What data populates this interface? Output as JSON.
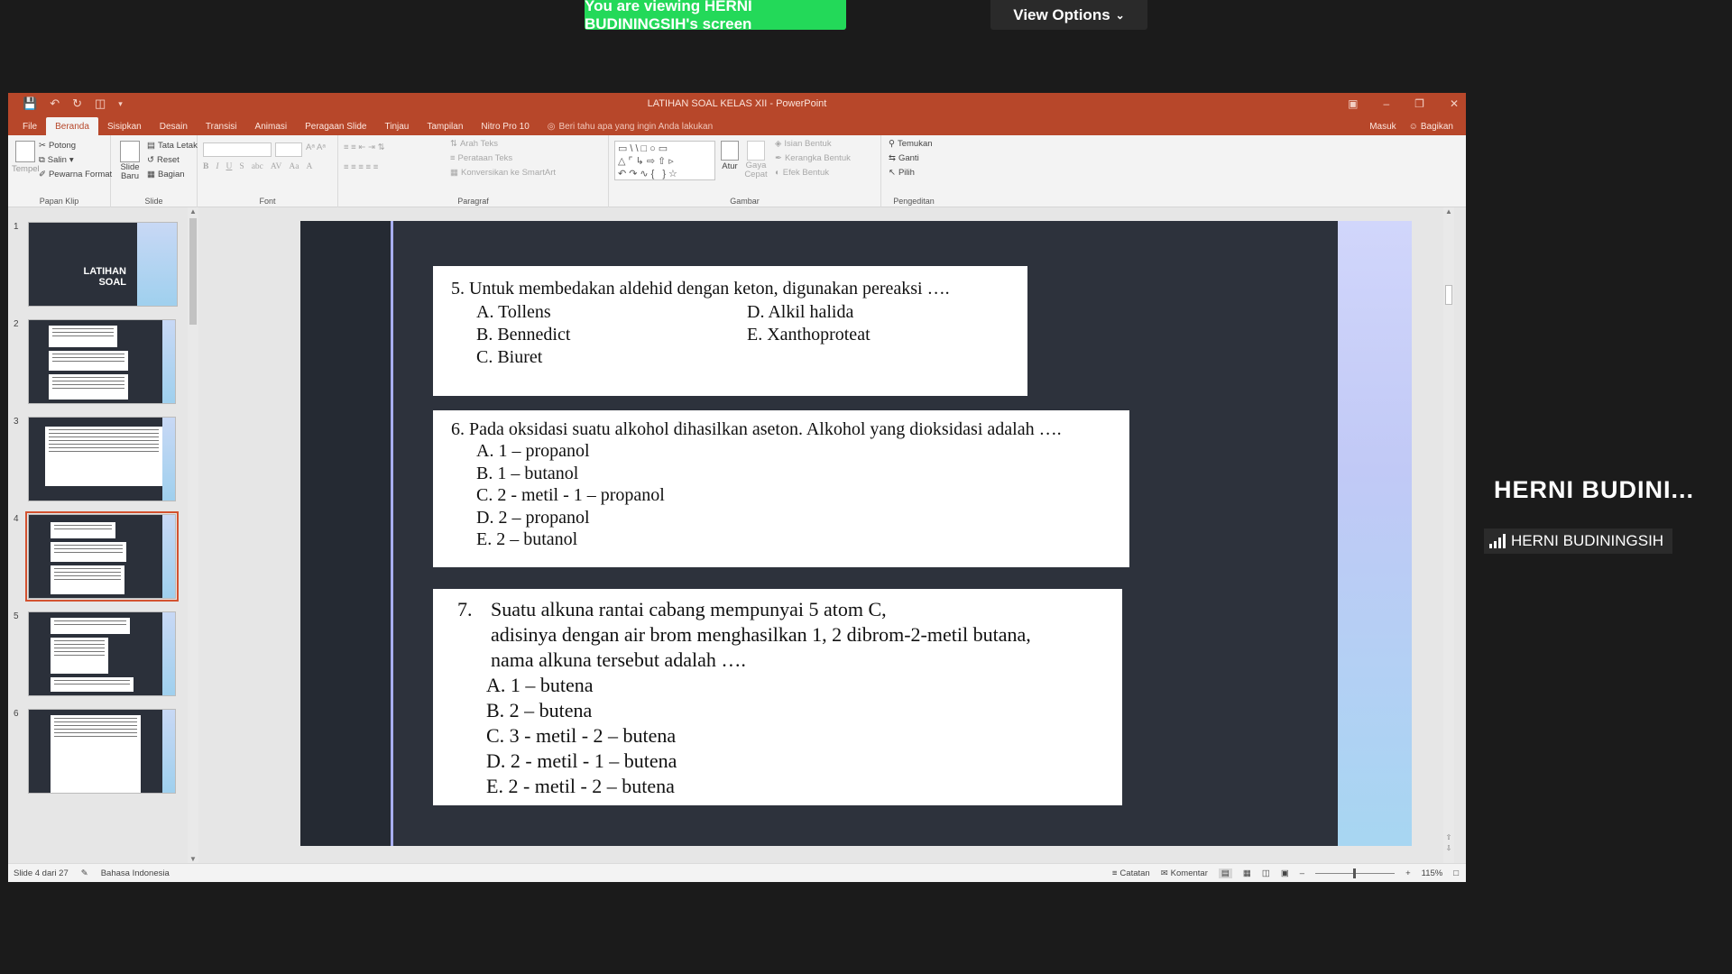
{
  "zoom": {
    "banner": "You are viewing HERNI BUDININGSIH's screen",
    "view_options": "View Options",
    "participant_big": "HERNI  BUDINI...",
    "participant_tag": "HERNI BUDININGSIH"
  },
  "window": {
    "title": "LATIHAN SOAL KELAS XII - PowerPoint"
  },
  "tabs": [
    "File",
    "Beranda",
    "Sisipkan",
    "Desain",
    "Transisi",
    "Animasi",
    "Peragaan Slide",
    "Tinjau",
    "Tampilan",
    "Nitro Pro 10"
  ],
  "active_tab": "Beranda",
  "tell_me": "Beri tahu apa yang ingin Anda lakukan",
  "account": {
    "signin": "Masuk",
    "share": "Bagikan"
  },
  "ribbon": {
    "clipboard": {
      "label": "Papan Klip",
      "paste": "Tempel",
      "cut": "Potong",
      "copy": "Salin",
      "format_painter": "Pewarna Format"
    },
    "slides": {
      "label": "Slide",
      "new_slide": "Slide Baru",
      "layout": "Tata Letak",
      "reset": "Reset",
      "section": "Bagian"
    },
    "font": {
      "label": "Font"
    },
    "paragraph": {
      "label": "Paragraf",
      "text_direction": "Arah Teks",
      "align_text": "Perataan Teks",
      "smartart": "Konversikan ke SmartArt"
    },
    "drawing": {
      "label": "Gambar",
      "arrange": "Atur",
      "quick_styles": "Gaya Cepat",
      "shape_fill": "Isian Bentuk",
      "shape_outline": "Kerangka Bentuk",
      "shape_effects": "Efek Bentuk"
    },
    "editing": {
      "label": "Pengeditan",
      "find": "Temukan",
      "replace": "Ganti",
      "select": "Pilih"
    }
  },
  "thumbnails": [
    {
      "num": "1",
      "title": "LATIHAN SOAL"
    },
    {
      "num": "2"
    },
    {
      "num": "3"
    },
    {
      "num": "4",
      "selected": true
    },
    {
      "num": "5"
    },
    {
      "num": "6"
    }
  ],
  "slide": {
    "q5": {
      "question": "5.   Untuk membedakan aldehid dengan keton, digunakan pereaksi ….",
      "a": "A.   Tollens",
      "b": "B.   Bennedict",
      "c": "C.   Biuret",
      "d": "D.   Alkil halida",
      "e": "E.   Xanthoproteat"
    },
    "q6": {
      "question": "6.   Pada oksidasi suatu alkohol dihasilkan aseton. Alkohol yang dioksidasi adalah ….",
      "a": "A.   1 – propanol",
      "b": "B.   1 – butanol",
      "c": "C.   2 - metil - 1 – propanol",
      "d": "D.   2 – propanol",
      "e": "E.   2 – butanol"
    },
    "q7": {
      "num": "7.",
      "line1": "Suatu alkuna rantai cabang mempunyai 5 atom C,",
      "line2": "adisinya dengan air brom menghasilkan 1, 2 dibrom-2-metil butana,",
      "line3": "nama alkuna tersebut adalah ….",
      "a": "A.   1 – butena",
      "b": "B.   2 – butena",
      "c": "C.   3 - metil - 2 – butena",
      "d": "D.   2 - metil - 1 – butena",
      "e": "E.   2 - metil - 2 – butena"
    }
  },
  "status": {
    "slide_info": "Slide 4 dari 27",
    "language": "Bahasa Indonesia",
    "notes": "Catatan",
    "comments": "Komentar",
    "zoom": "115%"
  }
}
